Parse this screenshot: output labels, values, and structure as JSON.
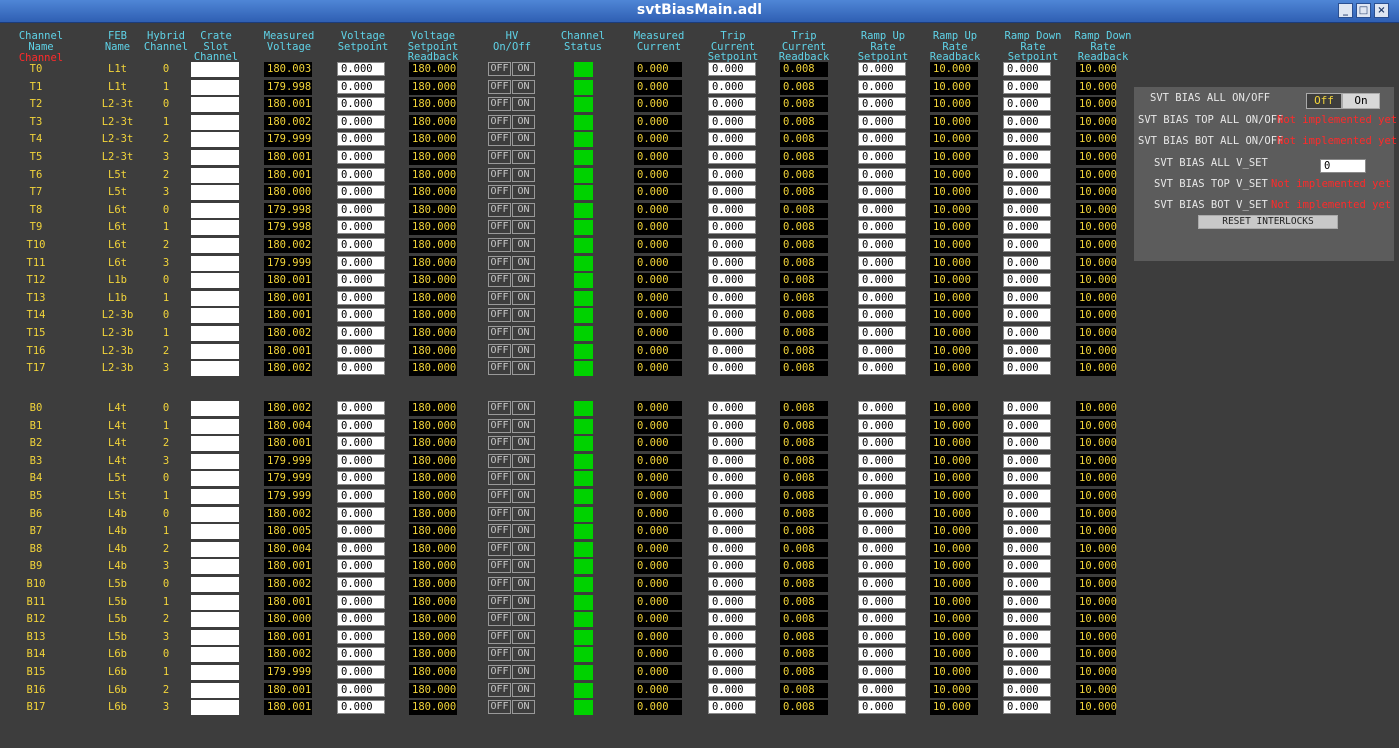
{
  "window": {
    "title": "svtBiasMain.adl"
  },
  "headers": {
    "channel_name": "Channel\nName",
    "channel_name_red": "Channel",
    "feb_name": "FEB\nName",
    "hybrid_channel": "Hybrid\nChannel",
    "crate_slot_channel": "Crate\nSlot\nChannel",
    "measured_voltage": "Measured\nVoltage",
    "voltage_setpoint": "Voltage\nSetpoint",
    "voltage_setpoint_readback": "Voltage\nSetpoint\nReadback",
    "hv_onoff": "HV\nOn/Off",
    "channel_status": "Channel\nStatus",
    "measured_current": "Measured\nCurrent",
    "trip_current_setpoint": "Trip\nCurrent\nSetpoint",
    "trip_current_readback": "Trip\nCurrent\nReadback",
    "ramp_up_rate_setpoint": "Ramp Up\nRate\nSetpoint",
    "ramp_up_rate_readback": "Ramp Up\nRate\nReadback",
    "ramp_down_rate_setpoint": "Ramp Down\nRate\nSetpoint",
    "ramp_down_rate_readback": "Ramp Down\nRate\nReadback"
  },
  "colors": {
    "header": "#5fd3e8",
    "value": "#f2d43a",
    "status_ok": "#00d200",
    "alert": "#ff2a2a",
    "background": "#3d3d3d"
  },
  "defaults": {
    "voltage_setpoint": "0.000",
    "voltage_readback": "180.000",
    "hv_off": "OFF",
    "hv_on": "ON",
    "measured_current": "0.000",
    "trip_setpoint": "0.000",
    "trip_readback": "0.008",
    "ramp_up_setpoint": "0.000",
    "ramp_up_readback": "10.000",
    "ramp_down_setpoint": "0.000",
    "ramp_down_readback": "10.000"
  },
  "top_rows": [
    {
      "name": "T0",
      "feb": "L1t",
      "hybrid": "0",
      "mv": "180.003"
    },
    {
      "name": "T1",
      "feb": "L1t",
      "hybrid": "1",
      "mv": "179.998"
    },
    {
      "name": "T2",
      "feb": "L2-3t",
      "hybrid": "0",
      "mv": "180.001"
    },
    {
      "name": "T3",
      "feb": "L2-3t",
      "hybrid": "1",
      "mv": "180.002"
    },
    {
      "name": "T4",
      "feb": "L2-3t",
      "hybrid": "2",
      "mv": "179.999"
    },
    {
      "name": "T5",
      "feb": "L2-3t",
      "hybrid": "3",
      "mv": "180.001"
    },
    {
      "name": "T6",
      "feb": "L5t",
      "hybrid": "2",
      "mv": "180.001"
    },
    {
      "name": "T7",
      "feb": "L5t",
      "hybrid": "3",
      "mv": "180.000"
    },
    {
      "name": "T8",
      "feb": "L6t",
      "hybrid": "0",
      "mv": "179.998"
    },
    {
      "name": "T9",
      "feb": "L6t",
      "hybrid": "1",
      "mv": "179.998"
    },
    {
      "name": "T10",
      "feb": "L6t",
      "hybrid": "2",
      "mv": "180.002"
    },
    {
      "name": "T11",
      "feb": "L6t",
      "hybrid": "3",
      "mv": "179.999"
    },
    {
      "name": "T12",
      "feb": "L1b",
      "hybrid": "0",
      "mv": "180.001"
    },
    {
      "name": "T13",
      "feb": "L1b",
      "hybrid": "1",
      "mv": "180.001"
    },
    {
      "name": "T14",
      "feb": "L2-3b",
      "hybrid": "0",
      "mv": "180.001"
    },
    {
      "name": "T15",
      "feb": "L2-3b",
      "hybrid": "1",
      "mv": "180.002"
    },
    {
      "name": "T16",
      "feb": "L2-3b",
      "hybrid": "2",
      "mv": "180.001"
    },
    {
      "name": "T17",
      "feb": "L2-3b",
      "hybrid": "3",
      "mv": "180.002"
    }
  ],
  "bottom_rows": [
    {
      "name": "B0",
      "feb": "L4t",
      "hybrid": "0",
      "mv": "180.002"
    },
    {
      "name": "B1",
      "feb": "L4t",
      "hybrid": "1",
      "mv": "180.004"
    },
    {
      "name": "B2",
      "feb": "L4t",
      "hybrid": "2",
      "mv": "180.001"
    },
    {
      "name": "B3",
      "feb": "L4t",
      "hybrid": "3",
      "mv": "179.999"
    },
    {
      "name": "B4",
      "feb": "L5t",
      "hybrid": "0",
      "mv": "179.999"
    },
    {
      "name": "B5",
      "feb": "L5t",
      "hybrid": "1",
      "mv": "179.999"
    },
    {
      "name": "B6",
      "feb": "L4b",
      "hybrid": "0",
      "mv": "180.002"
    },
    {
      "name": "B7",
      "feb": "L4b",
      "hybrid": "1",
      "mv": "180.005"
    },
    {
      "name": "B8",
      "feb": "L4b",
      "hybrid": "2",
      "mv": "180.004"
    },
    {
      "name": "B9",
      "feb": "L4b",
      "hybrid": "3",
      "mv": "180.001"
    },
    {
      "name": "B10",
      "feb": "L5b",
      "hybrid": "0",
      "mv": "180.002"
    },
    {
      "name": "B11",
      "feb": "L5b",
      "hybrid": "1",
      "mv": "180.001"
    },
    {
      "name": "B12",
      "feb": "L5b",
      "hybrid": "2",
      "mv": "180.000"
    },
    {
      "name": "B13",
      "feb": "L5b",
      "hybrid": "3",
      "mv": "180.001"
    },
    {
      "name": "B14",
      "feb": "L6b",
      "hybrid": "0",
      "mv": "180.002"
    },
    {
      "name": "B15",
      "feb": "L6b",
      "hybrid": "1",
      "mv": "179.999"
    },
    {
      "name": "B16",
      "feb": "L6b",
      "hybrid": "2",
      "mv": "180.001"
    },
    {
      "name": "B17",
      "feb": "L6b",
      "hybrid": "3",
      "mv": "180.001"
    }
  ],
  "panel": {
    "all_onoff_label": "SVT BIAS ALL ON/OFF",
    "toggle_off": "Off",
    "toggle_on": "On",
    "top_onoff_label": "SVT BIAS TOP ALL ON/OFF",
    "bot_onoff_label": "SVT BIAS BOT ALL ON/OFF",
    "not_implemented": "Not implemented yet",
    "all_vset_label": "SVT BIAS ALL V_SET",
    "all_vset_value": "0",
    "top_vset_label": "SVT BIAS TOP V_SET",
    "bot_vset_label": "SVT BIAS BOT V_SET",
    "reset_button": "RESET INTERLOCKS"
  }
}
